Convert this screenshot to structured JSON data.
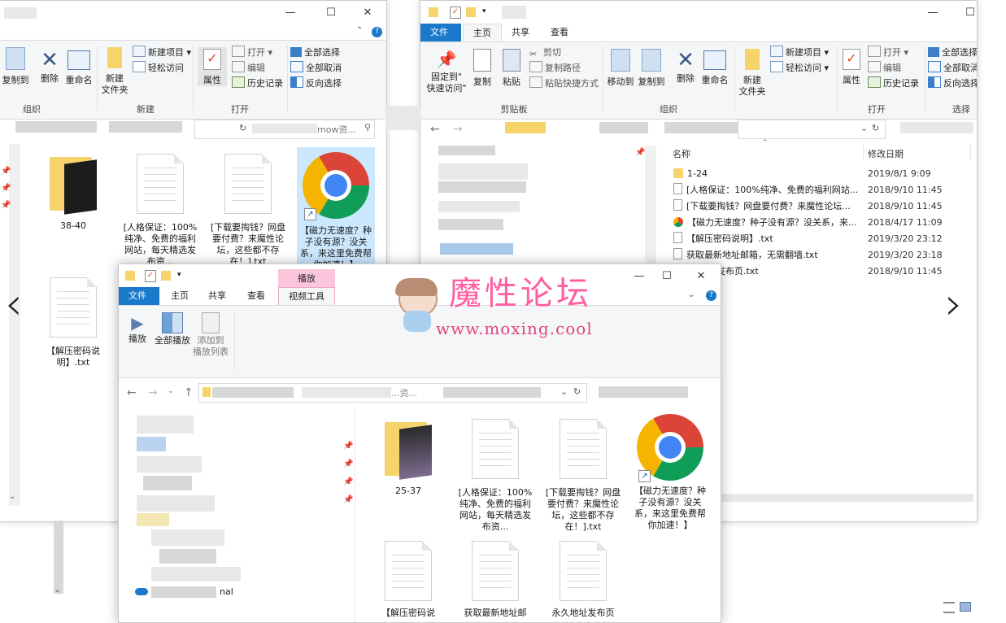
{
  "left_window": {
    "ribbon": {
      "copy_to": "复制到",
      "delete": "删除",
      "rename": "重命名",
      "new_folder_line1": "新建",
      "new_folder_line2": "文件夹",
      "new_item": "新建项目",
      "easy_access": "轻松访问",
      "properties": "属性",
      "open": "打开",
      "edit": "编辑",
      "history": "历史记录",
      "select_all": "全部选择",
      "select_none": "全部取消",
      "invert": "反向选择",
      "group_organize": "组织",
      "group_new": "新建",
      "group_open": "打开"
    },
    "address_tail": "mow资...",
    "files": [
      {
        "name": "38-40"
      },
      {
        "name": "[人格保证：100%纯净、免费的福利网站，每天精选发布资..."
      },
      {
        "name": "[下载要掏钱？网盘要付费？来魔性论坛，这些都不存在！].txt"
      },
      {
        "name": "【磁力无速度？种子没有源？没关系，来这里免费帮你加速！】"
      },
      {
        "name": "【解压密码说明】.txt"
      }
    ]
  },
  "right_window": {
    "tabs": {
      "file": "文件",
      "home": "主页",
      "share": "共享",
      "view": "查看"
    },
    "ribbon": {
      "pin_line1": "固定到\"",
      "pin_line2": "快速访问\"",
      "copy": "复制",
      "paste": "粘贴",
      "cut": "剪切",
      "copy_path": "复制路径",
      "paste_shortcut": "粘贴快捷方式",
      "move_to": "移动到",
      "copy_to": "复制到",
      "delete": "删除",
      "rename": "重命名",
      "new_folder_line1": "新建",
      "new_folder_line2": "文件夹",
      "new_item": "新建项目",
      "easy_access": "轻松访问",
      "properties": "属性",
      "open": "打开",
      "edit": "编辑",
      "history": "历史记录",
      "select_all": "全部选择",
      "select_none": "全部取消",
      "invert": "反向选择",
      "group_clipboard": "剪贴板",
      "group_organize": "组织",
      "group_open": "打开",
      "group_select": "选择"
    },
    "columns": {
      "name": "名称",
      "modified": "修改日期"
    },
    "rows": [
      {
        "name": "1-24",
        "date": "2019/8/1 9:09",
        "icon": "folder-icon"
      },
      {
        "name": "[人格保证：100%纯净、免费的福利网站...",
        "date": "2018/9/10 11:45",
        "icon": "document-icon"
      },
      {
        "name": "[下载要掏钱？网盘要付费？来魔性论坛...",
        "date": "2018/9/10 11:45",
        "icon": "document-icon"
      },
      {
        "name": "【磁力无速度？种子没有源？没关系，来...",
        "date": "2018/4/17 11:09",
        "icon": "chrome-icon"
      },
      {
        "name": "【解压密码说明】.txt",
        "date": "2019/3/20 23:12",
        "icon": "document-icon"
      },
      {
        "name": "获取最新地址邮箱，无需翻墙.txt",
        "date": "2019/3/20 23:18",
        "icon": "document-icon"
      },
      {
        "name": "址发布页.txt",
        "date": "2018/9/10 11:45",
        "icon": "document-icon"
      }
    ]
  },
  "front_window": {
    "tabs": {
      "file": "文件",
      "home": "主页",
      "share": "共享",
      "view": "查看",
      "play_context": "播放",
      "video_tools": "视频工具"
    },
    "ribbon": {
      "play": "播放",
      "play_all": "全部播放",
      "add_line1": "添加到",
      "add_line2": "播放列表"
    },
    "address_tail": "...资...",
    "nav_tail": "nal",
    "files": [
      {
        "name": "25-37"
      },
      {
        "name": "[人格保证：100%纯净、免费的福利网站，每天精选发布资..."
      },
      {
        "name": "[下载要掏钱？网盘要付费？来魔性论坛，这些都不存在！].txt"
      },
      {
        "name": "【磁力无速度？种子没有源？没关系，来这里免费帮你加速！】"
      },
      {
        "name": "【解压密码说"
      },
      {
        "name": "获取最新地址邮"
      },
      {
        "name": "永久地址发布页"
      }
    ]
  },
  "watermark": {
    "title": "魔性论坛",
    "url": "www.moxing.cool"
  },
  "colors": {
    "file_tab": "#1979ca",
    "context_tab": "#fbc5dc",
    "watermark": "#ff5fa2",
    "folder": "#f6d46b"
  }
}
